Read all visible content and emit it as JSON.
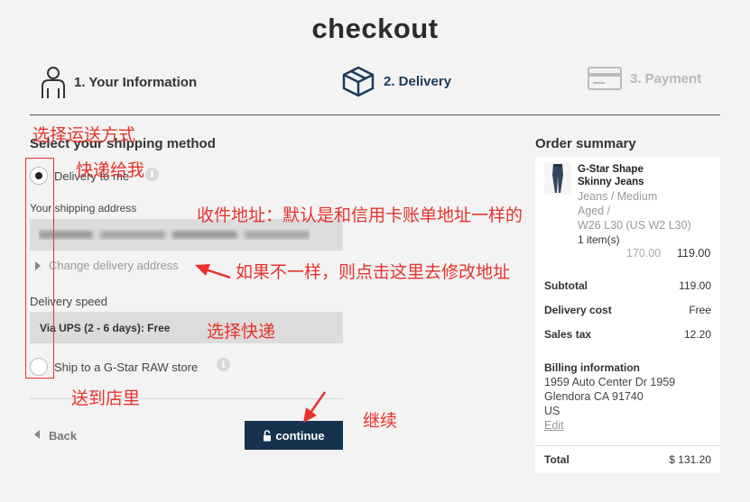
{
  "page": {
    "title": "checkout"
  },
  "steps": [
    {
      "label": "1. Your Information",
      "icon": "person-icon"
    },
    {
      "label": "2. Delivery",
      "icon": "box-icon"
    },
    {
      "label": "3. Payment",
      "icon": "credit-card-icon"
    }
  ],
  "shipping": {
    "heading": "Select your shipping method",
    "option_delivery": "Delivery to me",
    "address_label": "Your shipping address",
    "change_address": "Change delivery address",
    "speed_label": "Delivery speed",
    "speed_value": "Via UPS (2 - 6 days): Free",
    "option_store": "Ship to a G-Star RAW store",
    "info_glyph": "i"
  },
  "actions": {
    "back": "Back",
    "continue": "continue"
  },
  "summary": {
    "heading": "Order summary",
    "product": {
      "name_line1": "G-Star Shape",
      "name_line2": "Skinny Jeans",
      "desc_line1": "Jeans  /  Medium",
      "desc_line2": "Aged  /",
      "desc_line3": "W26 L30 (US W2 L30)",
      "qty": "1 item(s)",
      "old_price": "170.00",
      "price": "119.00"
    },
    "subtotal_label": "Subtotal",
    "subtotal_value": "119.00",
    "delivery_label": "Delivery cost",
    "delivery_value": "Free",
    "tax_label": "Sales tax",
    "tax_value": "12.20",
    "billing_label": "Billing information",
    "billing_line1": "1959 Auto Center Dr 1959",
    "billing_line2": "Glendora CA  91740",
    "billing_line3": "US",
    "billing_edit": "Edit",
    "total_label": "Total",
    "total_value": "$ 131.20"
  },
  "annotations": {
    "choose_method": "选择运送方式",
    "ship_to_me": "快递给我",
    "address_note": "收件地址：默认是和信用卡账单地址一样的",
    "change_note": "如果不一样，则点击这里去修改地址",
    "choose_courier": "选择快递",
    "to_store": "送到店里",
    "continue_note": "继续"
  },
  "colors": {
    "primary": "#16324f",
    "annotation": "#e8322b",
    "background": "#f3f3f3"
  }
}
